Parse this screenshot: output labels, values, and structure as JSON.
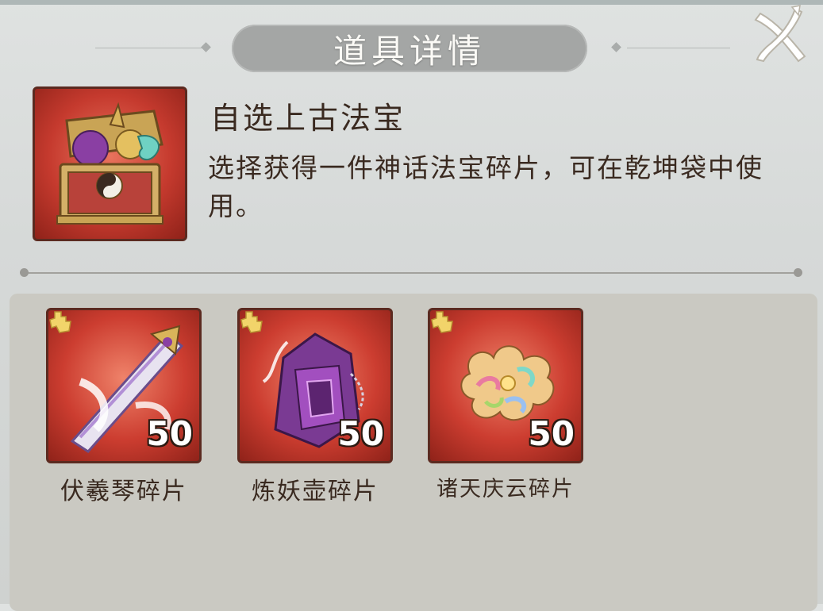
{
  "dialog": {
    "title": "道具详情",
    "close_icon": "close-x-icon"
  },
  "item": {
    "name": "自选上古法宝",
    "description": "选择获得一件神话法宝碎片，可在乾坤袋中使用。",
    "icon": "treasure-chest-icon"
  },
  "rewards": [
    {
      "name": "伏羲琴碎片",
      "count": "50",
      "icon": "fuxi-zither-icon"
    },
    {
      "name": "炼妖壶碎片",
      "count": "50",
      "icon": "demon-refining-pot-icon"
    },
    {
      "name": "诸天庆云碎片",
      "count": "50",
      "icon": "auspicious-cloud-icon"
    }
  ],
  "colors": {
    "card_red": "#cc3d30",
    "card_border": "#5b2a20",
    "title_pill": "#a4a6a5",
    "panel": "#cac9c2"
  }
}
